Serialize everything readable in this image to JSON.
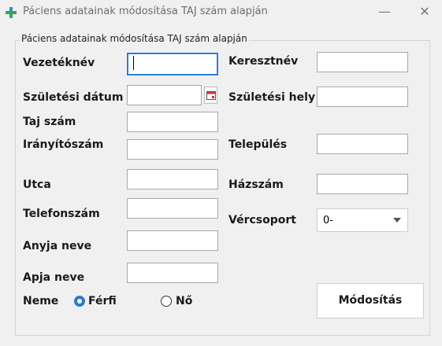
{
  "window": {
    "title": "Páciens adatainak módosítása TAJ szám alapján",
    "minimize_label": "—",
    "close_label": "✕"
  },
  "group": {
    "title": "Páciens adatainak módosítása TAJ szám alapján"
  },
  "labels": {
    "vezeteknev": "Vezetéknév",
    "keresztnev": "Keresztnév",
    "szuletesi_datum": "Születési dátum",
    "szuletesi_hely": "Születési hely",
    "taj_szam": "Taj szám",
    "iranyitoszam": "Irányítószám",
    "telepules": "Település",
    "utca": "Utca",
    "hazszam": "Házszám",
    "telefonszam": "Telefonszám",
    "vercsoport": "Vércsoport",
    "anyja_neve": "Anyja neve",
    "apja_neve": "Apja neve",
    "neme": "Neme"
  },
  "fields": {
    "vezeteknev": "",
    "keresztnev": "",
    "szuletesi_datum": "",
    "szuletesi_hely": "",
    "taj_szam": "",
    "iranyitoszam": "",
    "telepules": "",
    "utca": "",
    "hazszam": "",
    "telefonszam": "",
    "anyja_neve": "",
    "apja_neve": ""
  },
  "gender": {
    "options": [
      {
        "label": "Férfi",
        "selected": true
      },
      {
        "label": "Nő",
        "selected": false
      }
    ]
  },
  "blood_type": {
    "selected": "0-"
  },
  "buttons": {
    "modify": "Módosítás"
  },
  "icons": {
    "app": "medical-cross-icon",
    "date_picker": "calendar-icon"
  },
  "colors": {
    "accent": "#2a79d0",
    "app_icon": "#3aa655"
  }
}
